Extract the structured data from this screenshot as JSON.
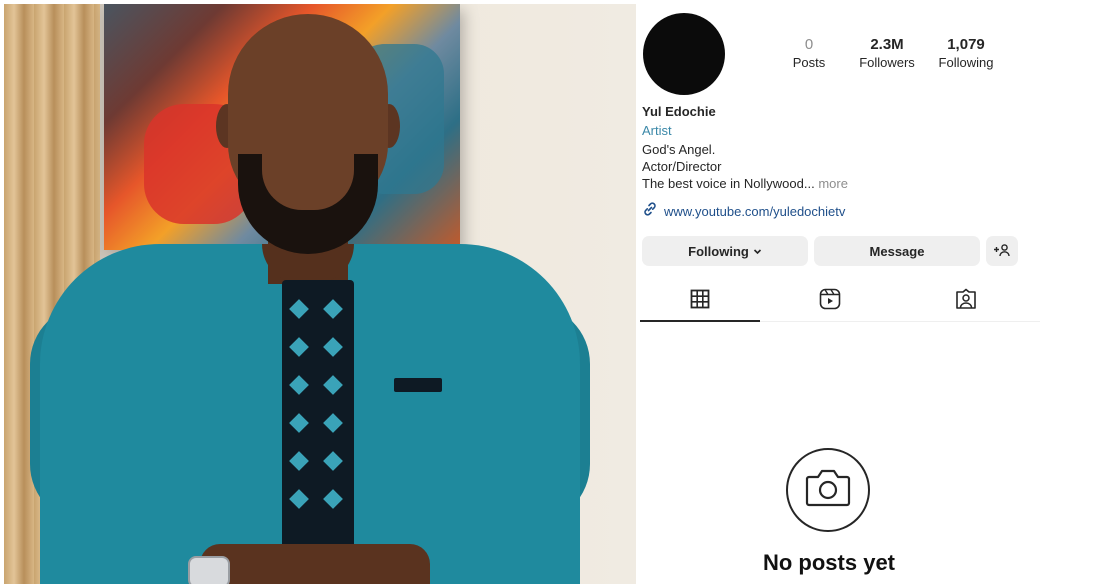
{
  "profile": {
    "stats": [
      {
        "value": "0",
        "label": "Posts"
      },
      {
        "value": "2.3M",
        "label": "Followers"
      },
      {
        "value": "1,079",
        "label": "Following"
      }
    ],
    "name": "Yul Edochie",
    "category": "Artist",
    "bio": [
      "God's Angel.",
      "Actor/Director",
      "The best voice in Nollywood..."
    ],
    "bio_more": "more",
    "link": "www.youtube.com/yuledochietv",
    "buttons": {
      "following": "Following",
      "message": "Message"
    },
    "tabs": [
      "grid-icon",
      "reels-icon",
      "tagged-icon"
    ],
    "empty_state": {
      "title": "No posts yet",
      "icon": "camera-icon"
    }
  },
  "colors": {
    "category": "#3b88a8",
    "link": "#1f4f8a",
    "button_bg": "#efefef",
    "shirt": "#1f8a9e"
  }
}
